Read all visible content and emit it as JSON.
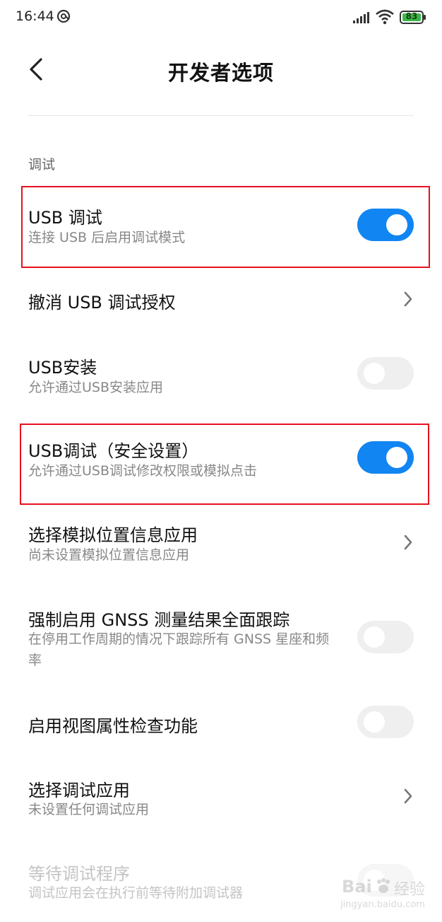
{
  "status_bar": {
    "time": "16:44",
    "battery": "83",
    "icons": [
      "at-icon",
      "signal-icon",
      "wifi-icon",
      "battery-icon"
    ]
  },
  "header": {
    "back_icon": "chevron-left-icon",
    "title": "开发者选项"
  },
  "section_label": "调试",
  "items": [
    {
      "title": "USB 调试",
      "subtitle": "连接 USB 后启用调试模式",
      "control": "toggle",
      "on": true,
      "highlighted": true
    },
    {
      "title": "撤消 USB 调试授权",
      "control": "chevron"
    },
    {
      "title": "USB安装",
      "subtitle": "允许通过USB安装应用",
      "control": "toggle",
      "on": false
    },
    {
      "title": "USB调试（安全设置）",
      "subtitle": "允许通过USB调试修改权限或模拟点击",
      "control": "toggle",
      "on": true,
      "highlighted": true
    },
    {
      "title": "选择模拟位置信息应用",
      "subtitle": "尚未设置模拟位置信息应用",
      "control": "chevron"
    },
    {
      "title": "强制启用 GNSS 测量结果全面跟踪",
      "subtitle": "在停用工作周期的情况下跟踪所有 GNSS 星座和频率",
      "control": "toggle",
      "on": false
    },
    {
      "title": "启用视图属性检查功能",
      "control": "toggle",
      "on": false
    },
    {
      "title": "选择调试应用",
      "subtitle": "未设置任何调试应用",
      "control": "chevron"
    },
    {
      "title": "等待调试程序",
      "subtitle": "调试应用会在执行前等待附加调试器",
      "control": "toggle",
      "on": false,
      "disabled": true
    }
  ],
  "watermark": {
    "text1": "Bai",
    "text2": "经验",
    "url": "jingyan.baidu.com"
  },
  "colors": {
    "accent": "#1185f2",
    "highlight": "#e8111e",
    "battery": "#3bb84a"
  }
}
